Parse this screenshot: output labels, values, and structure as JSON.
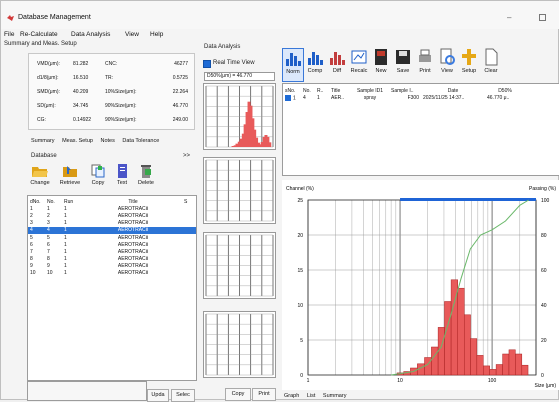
{
  "window": {
    "title": "Database Management"
  },
  "menu": [
    "File",
    "Re-Calculate",
    "Data Analysis",
    "View",
    "Help"
  ],
  "summary_section": {
    "header": "Summary and Meas. Setup",
    "left_stats": [
      {
        "label": "VMD(μm):",
        "value": "81.282"
      },
      {
        "label": "d1/8(μm):",
        "value": "16.510"
      },
      {
        "label": "SMD(μm):",
        "value": "40.209"
      },
      {
        "label": "SD(μm):",
        "value": "34.745"
      },
      {
        "label": "CG:",
        "value": "0.14922"
      }
    ],
    "right_stats": [
      {
        "label": "CNC:",
        "value": "46277"
      },
      {
        "label": "TR:",
        "value": "0.5725"
      },
      {
        "label": "10%Size(μm):",
        "value": "22.264"
      },
      {
        "label": "90%Size(μm):",
        "value": "46.770"
      },
      {
        "label": "90%Size(μm):",
        "value": "249.00"
      }
    ],
    "tabs": [
      "Summary",
      "Meas. Setup",
      "Notes",
      "Data Tolerance"
    ]
  },
  "database": {
    "header": "Database",
    "collapse": ">>",
    "tools": [
      "Change",
      "Retrieve",
      "Copy",
      "Text",
      "Delete"
    ],
    "columns": [
      "dNo.",
      "No.",
      "Run",
      "Title",
      "S"
    ],
    "rows": [
      {
        "dno": "1",
        "no": "1",
        "run": "1",
        "title": "AEROTRACⅡ"
      },
      {
        "dno": "2",
        "no": "2",
        "run": "1",
        "title": "AEROTRACⅡ"
      },
      {
        "dno": "3",
        "no": "3",
        "run": "1",
        "title": "AEROTRACⅡ"
      },
      {
        "dno": "4",
        "no": "4",
        "run": "1",
        "title": "AEROTRACⅡ"
      },
      {
        "dno": "5",
        "no": "5",
        "run": "1",
        "title": "AEROTRACⅡ"
      },
      {
        "dno": "6",
        "no": "6",
        "run": "1",
        "title": "AEROTRACⅡ"
      },
      {
        "dno": "7",
        "no": "7",
        "run": "1",
        "title": "AEROTRACⅡ"
      },
      {
        "dno": "8",
        "no": "8",
        "run": "1",
        "title": "AEROTRACⅡ"
      },
      {
        "dno": "9",
        "no": "9",
        "run": "1",
        "title": "AEROTRACⅡ"
      },
      {
        "dno": "10",
        "no": "10",
        "run": "1",
        "title": "AEROTRACⅡ"
      }
    ],
    "selected_row": 3,
    "buttons": [
      "Upda",
      "Selec"
    ]
  },
  "data_analysis": {
    "header": "Data Analysis",
    "realtime_label": "Real Time View",
    "d50_label": "D50%(μm) = 46.770",
    "copy_btn": "Copy",
    "print_btn": "Print",
    "tools": [
      "Norm",
      "Comp",
      "Diff",
      "Recalc",
      "New",
      "Save",
      "Print",
      "View",
      "Setup",
      "Clear"
    ],
    "grid_columns": [
      "sNo.",
      "No.",
      "R..",
      "Title",
      "Sample ID1",
      "Sample I..",
      "Date",
      "D50%"
    ],
    "grid_row": {
      "sno": "1",
      "no": "4",
      "r": "1",
      "title": "AER..",
      "sid1": "spray",
      "sid2": "F300",
      "date": "2025/11/25 14:37..",
      "d50": "46.770 μ.."
    },
    "bottom_tabs": [
      "Graph",
      "List",
      "Summary"
    ]
  },
  "chart_data": {
    "type": "bar",
    "ylabel": "Channel (%)",
    "y2label": "Passing (%)",
    "xlabel": "Size (μm)",
    "xscale": "log",
    "xlim": [
      1,
      300
    ],
    "ylim": [
      0,
      25
    ],
    "y2lim": [
      0,
      100
    ],
    "yticks": [
      0,
      5,
      10,
      15,
      20,
      25
    ],
    "y2ticks": [
      0,
      20,
      40,
      60,
      80,
      100
    ],
    "xticks": [
      1,
      10,
      100
    ],
    "bars": [
      {
        "x": 10,
        "v": 0.3
      },
      {
        "x": 12,
        "v": 0.5
      },
      {
        "x": 14,
        "v": 1.0
      },
      {
        "x": 17,
        "v": 1.6
      },
      {
        "x": 20,
        "v": 2.5
      },
      {
        "x": 24,
        "v": 4.0
      },
      {
        "x": 28,
        "v": 6.8
      },
      {
        "x": 33,
        "v": 10.5
      },
      {
        "x": 39,
        "v": 13.6
      },
      {
        "x": 46,
        "v": 12.4
      },
      {
        "x": 54,
        "v": 8.6
      },
      {
        "x": 63,
        "v": 5.2
      },
      {
        "x": 74,
        "v": 2.8
      },
      {
        "x": 87,
        "v": 1.3
      },
      {
        "x": 102,
        "v": 0.8
      },
      {
        "x": 120,
        "v": 1.5
      },
      {
        "x": 141,
        "v": 3.0
      },
      {
        "x": 165,
        "v": 3.6
      },
      {
        "x": 194,
        "v": 3.0
      },
      {
        "x": 228,
        "v": 1.4
      }
    ],
    "cumulative": [
      {
        "x": 8,
        "p": 0
      },
      {
        "x": 14,
        "p": 2
      },
      {
        "x": 20,
        "p": 6
      },
      {
        "x": 28,
        "p": 16
      },
      {
        "x": 36,
        "p": 35
      },
      {
        "x": 46,
        "p": 55
      },
      {
        "x": 58,
        "p": 72
      },
      {
        "x": 75,
        "p": 80
      },
      {
        "x": 100,
        "p": 83
      },
      {
        "x": 140,
        "p": 88
      },
      {
        "x": 200,
        "p": 97
      },
      {
        "x": 250,
        "p": 100
      }
    ],
    "colors": {
      "bar": "#e85a5a",
      "bar_edge": "#a82020",
      "line": "#6ab86a",
      "top": "#1f64d6"
    }
  }
}
